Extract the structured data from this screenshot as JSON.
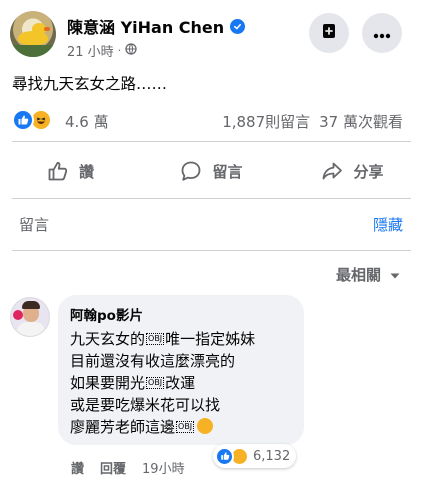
{
  "post": {
    "author": "陳意涵 YiHan Chen",
    "time": "21 小時",
    "text": "尋找九天玄女之路……"
  },
  "stats": {
    "reactions": "4.6 萬",
    "comments": "1,887則留言",
    "views": "37 萬次觀看"
  },
  "actions": {
    "like": "讚",
    "comment": "留言",
    "share": "分享"
  },
  "comments_bar": {
    "title": "留言",
    "hide": "隱藏"
  },
  "sort": {
    "label": "最相關"
  },
  "comment": {
    "author": "阿翰po影片",
    "lines": [
      "九天玄女的",
      "唯一指定姊妹",
      "目前還沒有收這麼漂亮的",
      "如果要開光",
      "改運",
      "或是要吃爆米花可以找",
      "廖麗芳老師這邊"
    ],
    "obj_mark": "OBJ",
    "reaction_count": "6,132",
    "like_label": "讚",
    "reply_label": "回覆",
    "time": "19小時"
  },
  "colors": {
    "accent": "#1877f2",
    "secondary_text": "#65676b",
    "haha": "#f7b125"
  }
}
